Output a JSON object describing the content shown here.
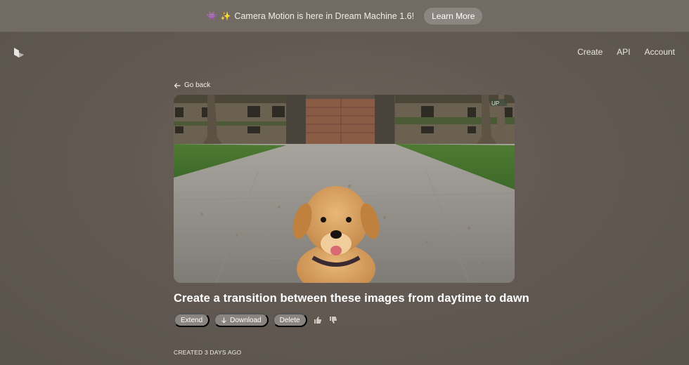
{
  "banner": {
    "emoji": "👾",
    "sparkle": "✨",
    "text": "Camera Motion is here in Dream Machine 1.6!",
    "button_label": "Learn More"
  },
  "nav": {
    "items": [
      "Create",
      "API",
      "Account"
    ]
  },
  "go_back_label": "Go back",
  "media": {
    "overlay_text": "UP"
  },
  "title": "Create a transition between these images from daytime to dawn",
  "actions": {
    "extend": "Extend",
    "download": "Download",
    "delete": "Delete"
  },
  "created": "CREATED 3 DAYS AGO",
  "colors": {
    "background": "#625a52",
    "banner": "#726b64",
    "pill": "#8a847e"
  }
}
